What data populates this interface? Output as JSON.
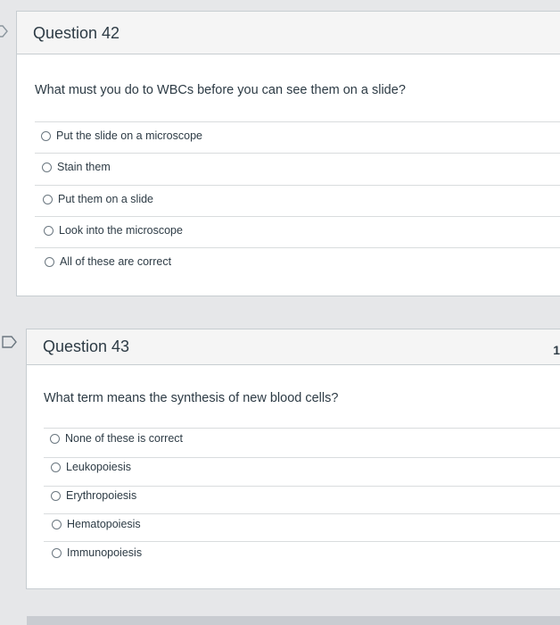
{
  "questions": [
    {
      "title": "Question 42",
      "prompt": "What must you do to WBCs before you can see them on a slide?",
      "options": [
        "Put the slide on a microscope",
        "Stain them",
        "Put them on a slide",
        "Look into the microscope",
        "All of these are correct"
      ]
    },
    {
      "title": "Question 43",
      "prompt": "What term means the synthesis of new blood cells?",
      "points_partial": "1",
      "options": [
        "None of these is correct",
        "Leukopoiesis",
        "Erythropoiesis",
        "Hematopoiesis",
        "Immunopoiesis"
      ]
    }
  ],
  "icons": {
    "q42_flag": "flag-icon",
    "q43_flag": "flag-icon",
    "radio": "radio-button-icon"
  },
  "colors": {
    "text": "#2d3b45",
    "header_bg": "#f5f5f5",
    "border": "#c7cdd1"
  }
}
